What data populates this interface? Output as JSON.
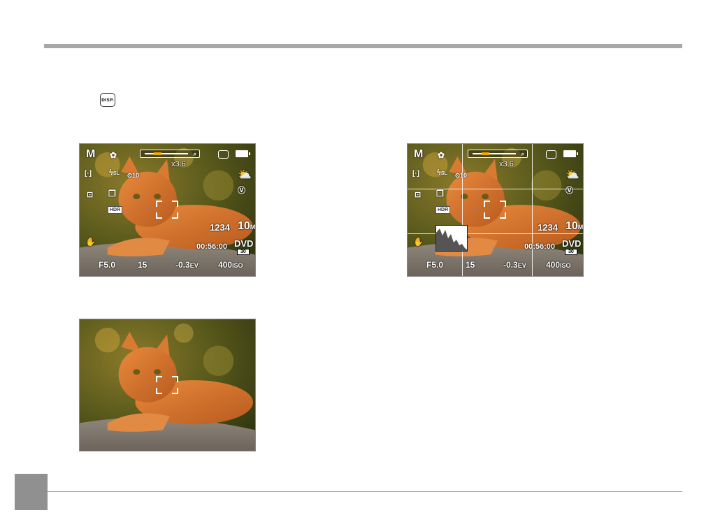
{
  "disp_button": {
    "label": "DISP."
  },
  "screens": {
    "overlay": {
      "mode": "M",
      "zoom_level": 0.3,
      "zoom_label": "x3.6",
      "shots_remaining": "1234",
      "resolution": "10",
      "resolution_unit": "M",
      "record_time": "00:56:00",
      "video_format": "DVD",
      "video_fps": "30",
      "aperture": "F5.0",
      "shutter": "15",
      "ev_value": "-0.3",
      "ev_unit": "EV",
      "iso_value": "400",
      "iso_unit": "ISO",
      "hdr_label": "HDR",
      "self_timer": "10",
      "flash_label": "SL"
    }
  },
  "icons": [
    "disp-button-icon",
    "macro-icon",
    "zoom-search-icon",
    "memory-card-icon",
    "battery-icon",
    "af-spot-icon",
    "flash-icon",
    "self-timer-icon",
    "weather-icon",
    "video-stabilizer-icon",
    "metering-icon",
    "continuous-shot-icon",
    "hdr-icon",
    "stabilizer-hand-icon"
  ]
}
